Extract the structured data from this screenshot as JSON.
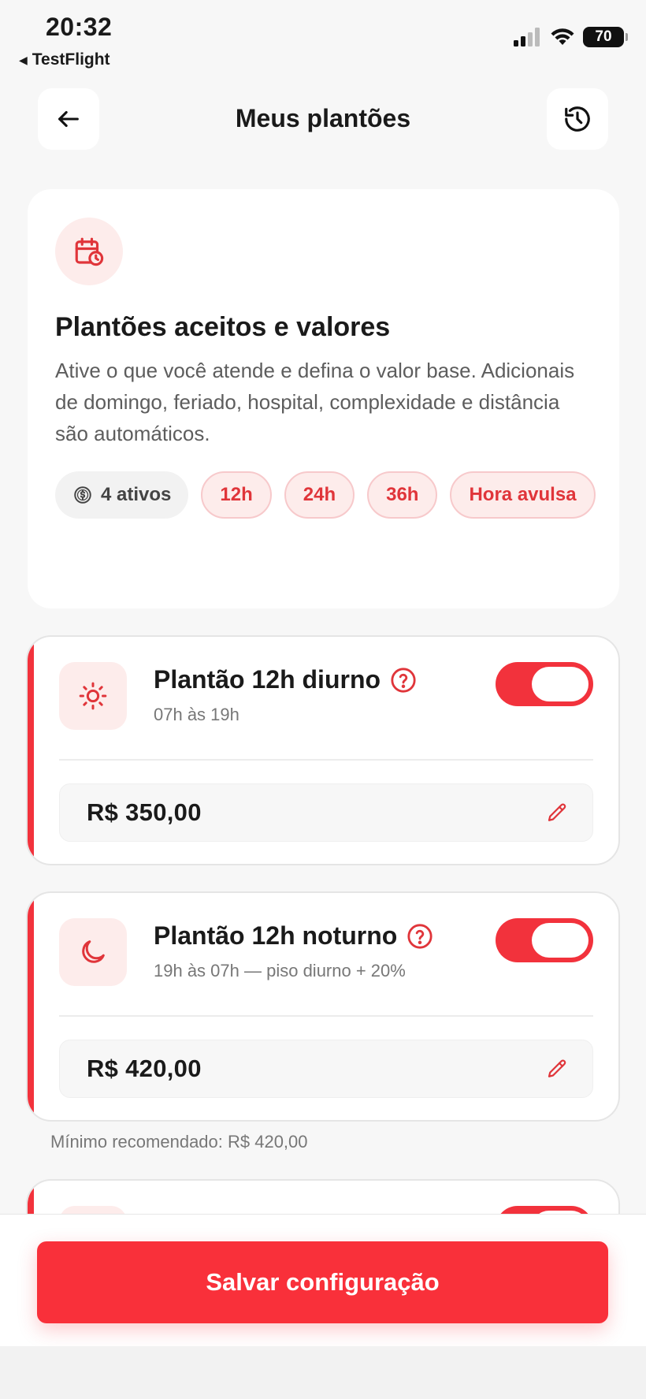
{
  "status_bar": {
    "time": "20:32",
    "back_app": "TestFlight",
    "battery": "70"
  },
  "header": {
    "title": "Meus plantões",
    "back_icon": "arrow-left-icon",
    "history_icon": "history-icon"
  },
  "intro": {
    "icon": "calendar-clock-icon",
    "title": "Plantões aceitos e valores",
    "description": "Ative o que você atende e defina o valor base. Adicionais de domingo, feriado, hospital, complexidade e distância são automáticos.",
    "chips": {
      "active": "4 ativos",
      "items": [
        "12h",
        "24h",
        "36h",
        "Hora avulsa"
      ]
    }
  },
  "shifts": [
    {
      "icon": "sun-icon",
      "title": "Plantão 12h diurno",
      "subtitle": "07h às 19h",
      "enabled": true,
      "price": "R$ 350,00"
    },
    {
      "icon": "moon-icon",
      "title": "Plantão 12h noturno",
      "subtitle": "19h às 07h — piso diurno + 20%",
      "enabled": true,
      "price": "R$ 420,00"
    }
  ],
  "hint": "Mínimo recomendado: R$ 420,00",
  "footer": {
    "save_label": "Salvar configuração"
  },
  "colors": {
    "accent": "#f2323c",
    "accent_soft": "#fdeceb"
  }
}
